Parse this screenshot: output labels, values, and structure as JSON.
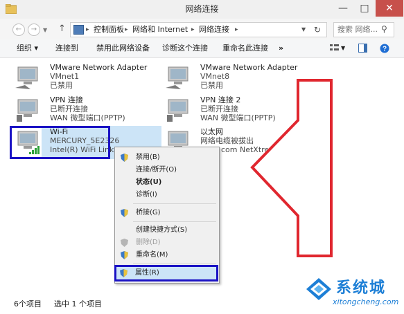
{
  "window": {
    "title": "网络连接"
  },
  "address": {
    "crumbs": [
      "控制面板",
      "网络和 Internet",
      "网络连接"
    ],
    "search_placeholder": "搜索 网络..."
  },
  "commands": {
    "organize": "组织 ▾",
    "connect": "连接到",
    "disable": "禁用此网络设备",
    "diagnose": "诊断这个连接",
    "rename": "重命名此连接",
    "more": "»"
  },
  "items": [
    {
      "name": "VMware Network Adapter",
      "line1": "VMnet1",
      "line2": "已禁用"
    },
    {
      "name": "VMware Network Adapter",
      "line1": "VMnet8",
      "line2": "已禁用"
    },
    {
      "name": "VPN 连接",
      "line1": "已断开连接",
      "line2": "WAN 微型端口(PPTP)"
    },
    {
      "name": "VPN 连接 2",
      "line1": "已断开连接",
      "line2": "WAN 微型端口(PPTP)"
    },
    {
      "name": "Wi-Fi",
      "line1": "MERCURY_5E2326",
      "line2": "Intel(R) WiFi Link 5"
    },
    {
      "name": "以太网",
      "line1": "网络电缆被拔出",
      "line2": "com NetXtreme 57xx Gi..."
    }
  ],
  "context_menu": [
    {
      "label": "禁用(B)"
    },
    {
      "label": "连接/断开(O)"
    },
    {
      "label": "状态(U)"
    },
    {
      "label": "诊断(I)"
    },
    {
      "label": "桥接(G)"
    },
    {
      "label": "创建快捷方式(S)"
    },
    {
      "label": "删除(D)"
    },
    {
      "label": "重命名(M)"
    },
    {
      "label": "属性(R)"
    }
  ],
  "status": {
    "count": "6个项目",
    "selected": "选中 1 个项目"
  },
  "watermark": {
    "text": "系统城",
    "url": "xitongcheng.com"
  },
  "colors": {
    "highlight_border": "#1a12c4",
    "arrow": "#e0272f",
    "selection": "#cce4f7"
  }
}
